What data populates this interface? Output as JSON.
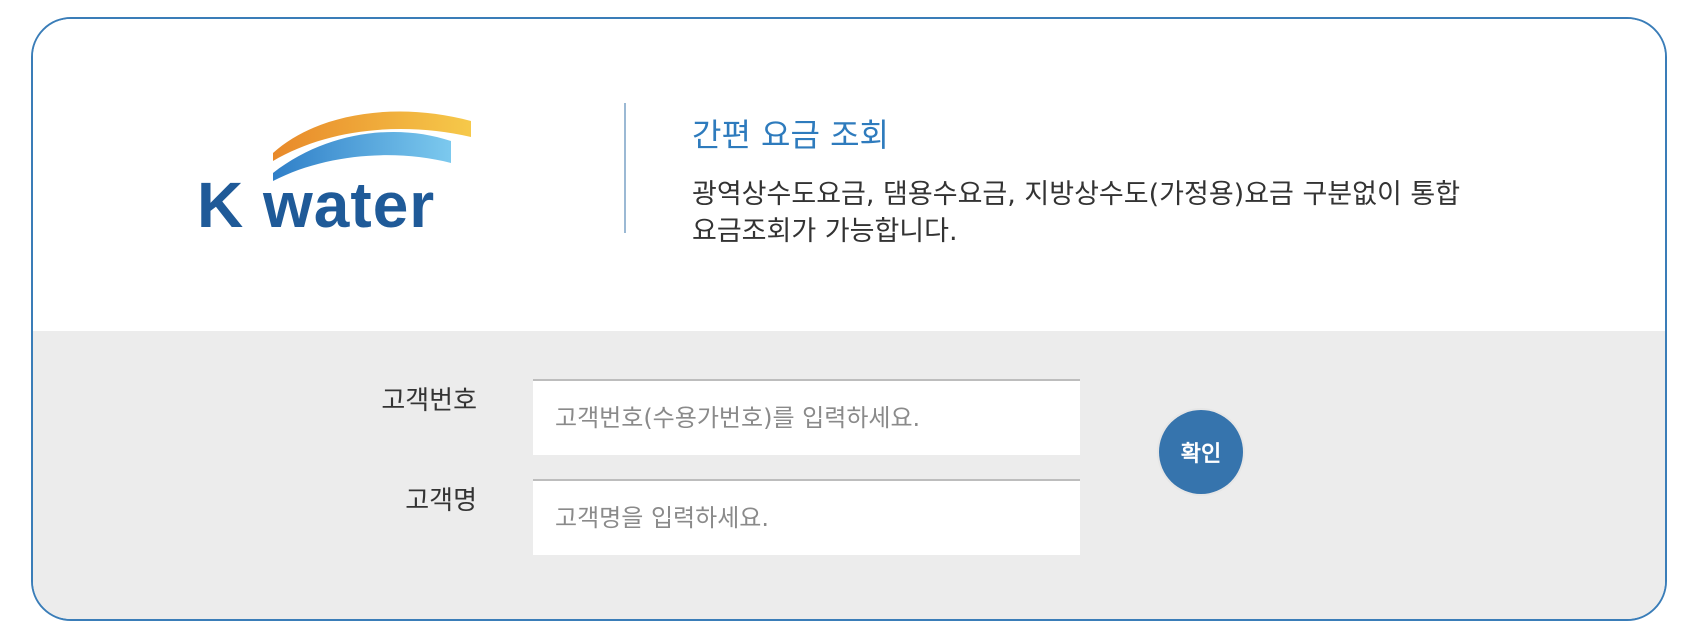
{
  "logo": {
    "text": "K water"
  },
  "header": {
    "title": "간편 요금 조회",
    "description_line1": "광역상수도요금, 댐용수요금, 지방상수도(가정용)요금 구분없이 통합",
    "description_line2": "요금조회가 가능합니다."
  },
  "form": {
    "customer_id_label": "고객번호",
    "customer_id_placeholder": "고객번호(수용가번호)를 입력하세요.",
    "customer_id_value": "",
    "customer_name_label": "고객명",
    "customer_name_placeholder": "고객명을 입력하세요.",
    "customer_name_value": "",
    "confirm_label": "확인"
  },
  "colors": {
    "border": "#3a7db8",
    "title": "#2e7bbd",
    "button": "#3674ad",
    "panel_bg": "#ececec",
    "logo_text": "#1f5a98",
    "logo_arc_orange": "#f0a233",
    "logo_arc_blue": "#4ea6de"
  }
}
